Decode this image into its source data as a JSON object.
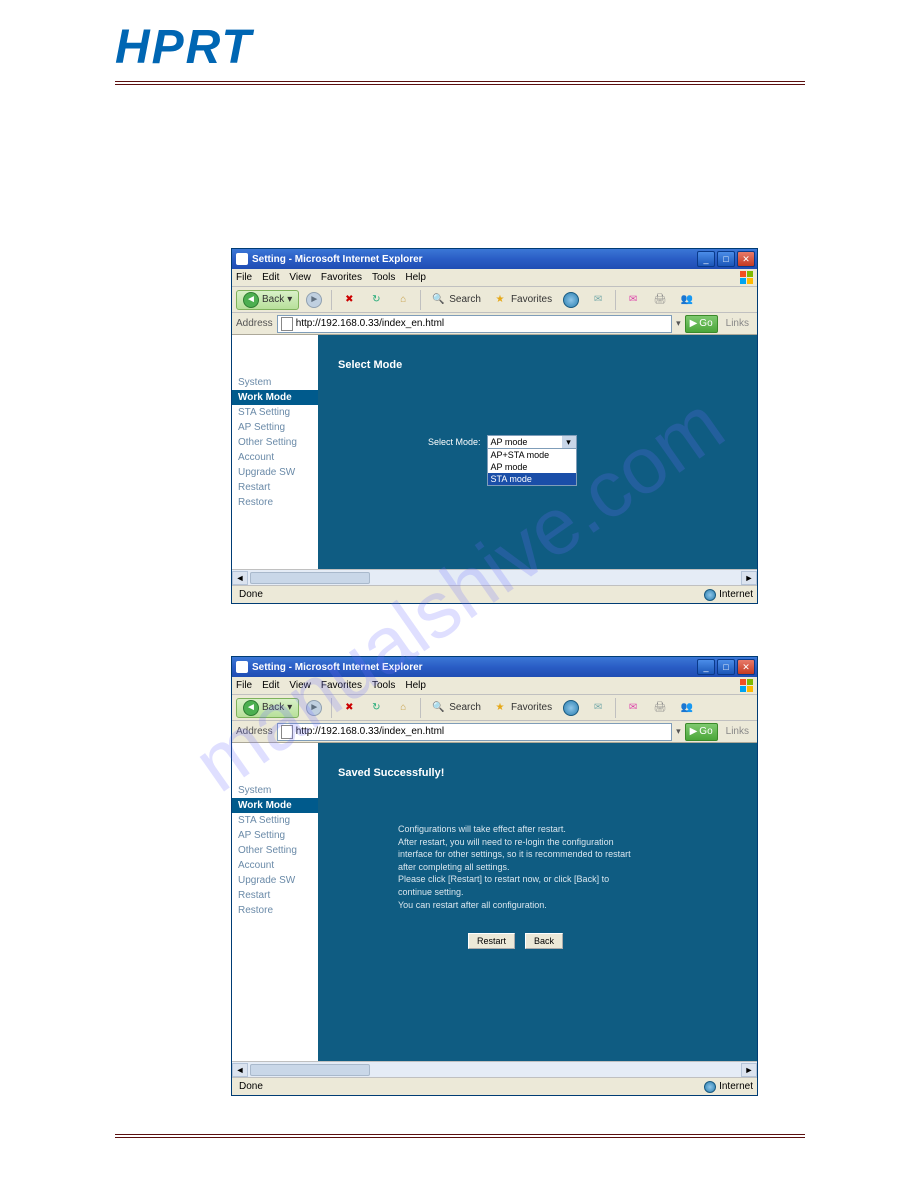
{
  "logo_text": "HPRT",
  "watermark_text": "manualshive.com",
  "ie_window": {
    "title": "Setting - Microsoft Internet Explorer",
    "menus": [
      "File",
      "Edit",
      "View",
      "Favorites",
      "Tools",
      "Help"
    ],
    "toolbar": {
      "back": "Back",
      "search": "Search",
      "favorites": "Favorites"
    },
    "address_label": "Address",
    "address_url": "http://192.168.0.33/index_en.html",
    "go_label": "Go",
    "links_label": "Links",
    "status_done": "Done",
    "status_zone": "Internet"
  },
  "sidebar_items": [
    "System",
    "Work Mode",
    "STA Setting",
    "AP Setting",
    "Other Setting",
    "Account",
    "Upgrade SW",
    "Restart",
    "Restore"
  ],
  "shot1": {
    "panel_title": "Select Mode",
    "select_label": "Select Mode:",
    "selected_value": "AP mode",
    "options": [
      "AP+STA mode",
      "AP mode",
      "STA mode"
    ],
    "highlighted_index": 2
  },
  "shot2": {
    "panel_title": "Saved Successfully!",
    "msg_lines": [
      "Configurations will take effect after restart.",
      "After restart, you will need to re-login the configuration",
      "interface for other settings, so it is recommended to restart",
      "after completing all settings.",
      "Please click [Restart] to restart now, or click [Back] to",
      "continue setting.",
      "You can restart after all configuration."
    ],
    "btn_restart": "Restart",
    "btn_back": "Back"
  }
}
